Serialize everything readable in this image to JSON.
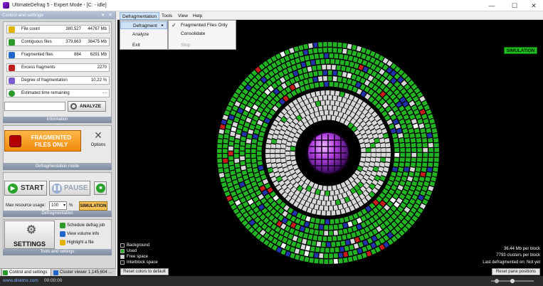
{
  "window": {
    "title": "UltimateDefrag 5 - Expert Mode - [C: - idle]",
    "min_glyph": "—",
    "max_glyph": "☐",
    "close_glyph": "✕"
  },
  "left_panel": {
    "header": "Control and settings",
    "header_pin": "▾",
    "header_close": "✕",
    "stats": [
      {
        "label": "File count",
        "v1": "380,527",
        "v2": "44767 Mb",
        "icon": "file-count-icon",
        "color": "#e0b400"
      },
      {
        "label": "Contiguous files",
        "v1": "379,663",
        "v2": "38475 Mb",
        "icon": "contiguous-files-icon",
        "color": "#2b9a2b"
      },
      {
        "label": "Fragmented files",
        "v1": "864",
        "v2": "6291 Mb",
        "icon": "fragmented-files-icon",
        "color": "#2266cc"
      },
      {
        "label": "Excess fragments",
        "v1": "",
        "v2": "2270",
        "icon": "excess-fragments-icon",
        "color": "#c02020"
      },
      {
        "label": "Degree of fragmentation",
        "v1": "",
        "v2": "10,22 %",
        "icon": "degree-icon",
        "color": "#7a5bd0"
      },
      {
        "label": "Estimated time remaining",
        "v1": "",
        "v2": "- -",
        "icon": "clock-icon",
        "color": "#2b9a2b"
      }
    ],
    "analyze_label": "ANALYZE",
    "info_footer": "Information",
    "mode_button": "FRAGMENTED FILES ONLY",
    "mode_line1": "FRAGMENTED",
    "mode_line2": "FILES ONLY",
    "options_label": "Options",
    "mode_footer": "Defragmentation mode",
    "start_label": "START",
    "pause_label": "PAUSE",
    "max_resource_label": "Max resource usage:",
    "max_resource_value": "100",
    "percent": "%",
    "simulation_label": "SIMULATION",
    "defrag_footer": "Defragmentation",
    "settings_label": "SETTINGS",
    "links": [
      "Schedule defrag job",
      "View volume info",
      "Highlight a file"
    ],
    "tools_footer": "Tools and settings",
    "tabs": [
      "Control and settings",
      "Cluster viewer",
      "1,145,604 ..."
    ]
  },
  "menu": {
    "items": [
      "Defragmentation",
      "Tools",
      "View",
      "Help"
    ]
  },
  "dropdown_main": {
    "items": [
      "Defragment",
      "Analyze",
      "Exit"
    ]
  },
  "dropdown_sub": {
    "items": [
      "Fragmented Files Only",
      "Consolidate",
      "Stop"
    ]
  },
  "main": {
    "simulation_badge": "SIMULATION",
    "legend": [
      {
        "label": "Background",
        "color": "#000000"
      },
      {
        "label": "Used",
        "color": "#22b422"
      },
      {
        "label": "Free space",
        "color": "#d8d8d8"
      },
      {
        "label": "Interblock space",
        "color": "#101010"
      }
    ],
    "info_lines": [
      "36.44 Mb per block",
      "7793 clusters per block",
      "Last defragmented on: Not yet"
    ],
    "reset_colors": "Reset colors to default",
    "reset_panes": "Reset pane positions"
  },
  "status": {
    "brand": "www.disktrix.com",
    "time": "00:00:00"
  },
  "colors": {
    "used": "#22b422",
    "free": "#d8d8d8",
    "fragmented": "#2233aa",
    "red": "#c81c1c",
    "white": "#ffffff"
  }
}
